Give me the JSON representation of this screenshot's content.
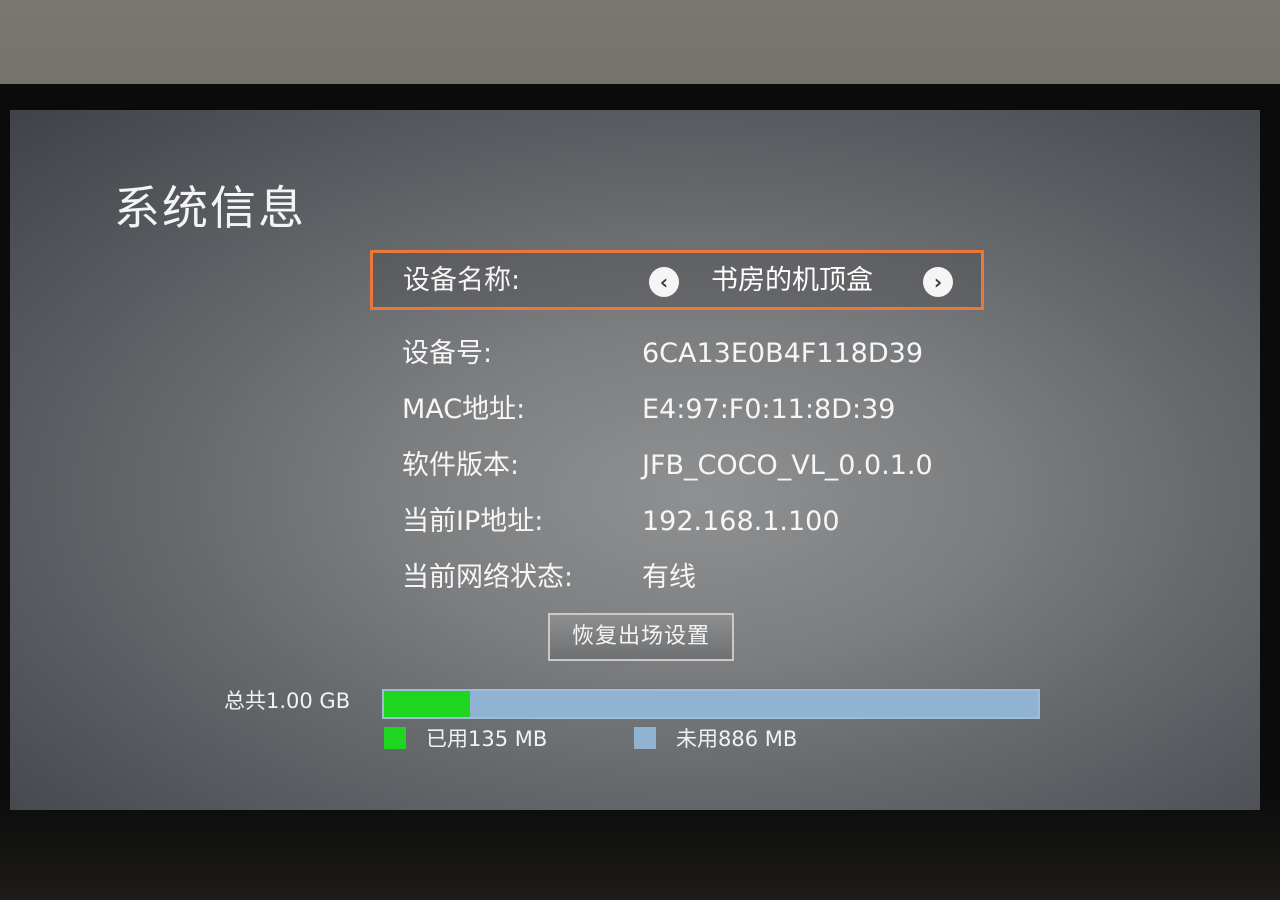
{
  "page": {
    "title": "系统信息"
  },
  "device_name": {
    "label": "设备名称:",
    "value": "书房的机顶盒"
  },
  "info_rows": [
    {
      "label": "设备号:",
      "value": "6CA13E0B4F118D39"
    },
    {
      "label": "MAC地址:",
      "value": "E4:97:F0:11:8D:39"
    },
    {
      "label": "软件版本:",
      "value": "JFB_COCO_VL_0.0.1.0"
    },
    {
      "label": "当前IP地址:",
      "value": "192.168.1.100"
    },
    {
      "label": "当前网络状态:",
      "value": "有线"
    }
  ],
  "reset_button": {
    "label": "恢复出场设置"
  },
  "storage": {
    "total_label": "总共1.00 GB",
    "used_label": "已用135 MB",
    "free_label": "未用886 MB",
    "used_fraction": 0.132,
    "used_color": "#1fd51f",
    "free_color": "#8fb3d1"
  },
  "icons": {
    "prev": "arrow-left-icon",
    "next": "arrow-right-icon"
  },
  "colors": {
    "focus_border": "#e8793a"
  }
}
